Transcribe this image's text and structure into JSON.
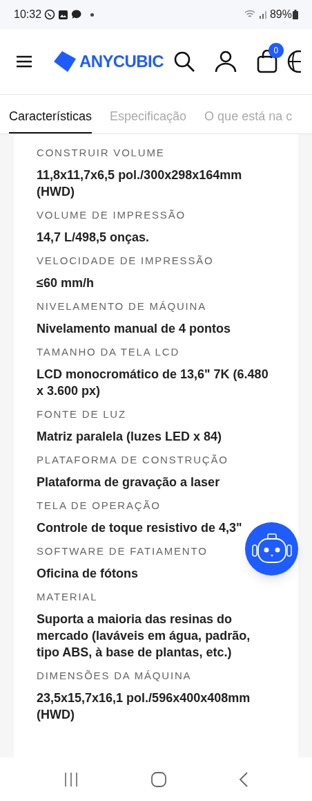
{
  "status_bar": {
    "time": "10:32",
    "battery": "89%"
  },
  "header": {
    "logo": "ANYCUBIC",
    "cart_count": "0"
  },
  "tabs": [
    {
      "label": "Características",
      "selected": true
    },
    {
      "label": "Especificação",
      "selected": false
    },
    {
      "label": "O que está na c",
      "selected": false
    }
  ],
  "specs": [
    {
      "label": "CONSTRUIR VOLUME",
      "value": "11,8x11,7x6,5 pol./300x298x164mm (HWD)"
    },
    {
      "label": "VOLUME DE IMPRESSÃO",
      "value": "14,7 L/498,5 onças."
    },
    {
      "label": "VELOCIDADE DE IMPRESSÃO",
      "value": "≤60 mm/h"
    },
    {
      "label": "NIVELAMENTO DE MÁQUINA",
      "value": "Nivelamento manual de 4 pontos"
    },
    {
      "label": "TAMANHO DA TELA LCD",
      "value": "LCD monocromático de 13,6\" 7K (6.480 x 3.600 px)"
    },
    {
      "label": "FONTE DE LUZ",
      "value": "Matriz paralela (luzes LED x 84)"
    },
    {
      "label": "PLATAFORMA DE CONSTRUÇÃO",
      "value": "Plataforma de gravação a laser"
    },
    {
      "label": "TELA DE OPERAÇÃO",
      "value": "Controle de toque resistivo de 4,3\""
    },
    {
      "label": "SOFTWARE DE FATIAMENTO",
      "value": "Oficina de fótons"
    },
    {
      "label": "MATERIAL",
      "value": "Suporta a maioria das resinas do mercado (laváveis em água, padrão, tipo ABS, à base de plantas, etc.)"
    },
    {
      "label": "DIMENSÕES DA MÁQUINA",
      "value": "23,5x15,7x16,1 pol./596x400x408mm (HWD)"
    }
  ]
}
